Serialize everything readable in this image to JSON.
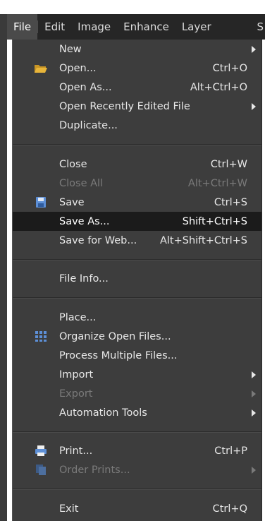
{
  "menubar": {
    "items": [
      {
        "label": "File",
        "active": true
      },
      {
        "label": "Edit"
      },
      {
        "label": "Image"
      },
      {
        "label": "Enhance"
      },
      {
        "label": "Layer"
      }
    ],
    "overflow_label": "S"
  },
  "file_menu": {
    "groups": [
      [
        {
          "label": "New",
          "submenu": true
        },
        {
          "label": "Open...",
          "shortcut": "Ctrl+O",
          "icon": "folder-icon"
        },
        {
          "label": "Open As...",
          "shortcut": "Alt+Ctrl+O"
        },
        {
          "label": "Open Recently Edited File",
          "submenu": true
        },
        {
          "label": "Duplicate..."
        }
      ],
      [
        {
          "label": "Close",
          "shortcut": "Ctrl+W"
        },
        {
          "label": "Close All",
          "shortcut": "Alt+Ctrl+W",
          "disabled": true
        },
        {
          "label": "Save",
          "shortcut": "Ctrl+S",
          "icon": "floppy-disk-icon"
        },
        {
          "label": "Save As...",
          "shortcut": "Shift+Ctrl+S",
          "highlighted": true
        },
        {
          "label": "Save for Web...",
          "shortcut": "Alt+Shift+Ctrl+S"
        }
      ],
      [
        {
          "label": "File Info..."
        }
      ],
      [
        {
          "label": "Place..."
        },
        {
          "label": "Organize Open Files...",
          "icon": "grid-icon"
        },
        {
          "label": "Process Multiple Files..."
        },
        {
          "label": "Import",
          "submenu": true
        },
        {
          "label": "Export",
          "submenu": true,
          "disabled": true
        },
        {
          "label": "Automation Tools",
          "submenu": true
        }
      ],
      [
        {
          "label": "Print...",
          "shortcut": "Ctrl+P",
          "icon": "printer-icon"
        },
        {
          "label": "Order Prints...",
          "submenu": true,
          "disabled": true,
          "icon": "order-prints-icon"
        }
      ],
      [
        {
          "label": "Exit",
          "shortcut": "Ctrl+Q"
        }
      ]
    ]
  },
  "colors": {
    "menu_bg": "#3d3d3d",
    "menubar_bg": "#262626",
    "highlight_bg": "#1b1b1b",
    "text": "#e8e8e8",
    "disabled_text": "#7a7a7a",
    "folder_icon": "#e8b53a",
    "blue_icon": "#5d8fd6"
  }
}
